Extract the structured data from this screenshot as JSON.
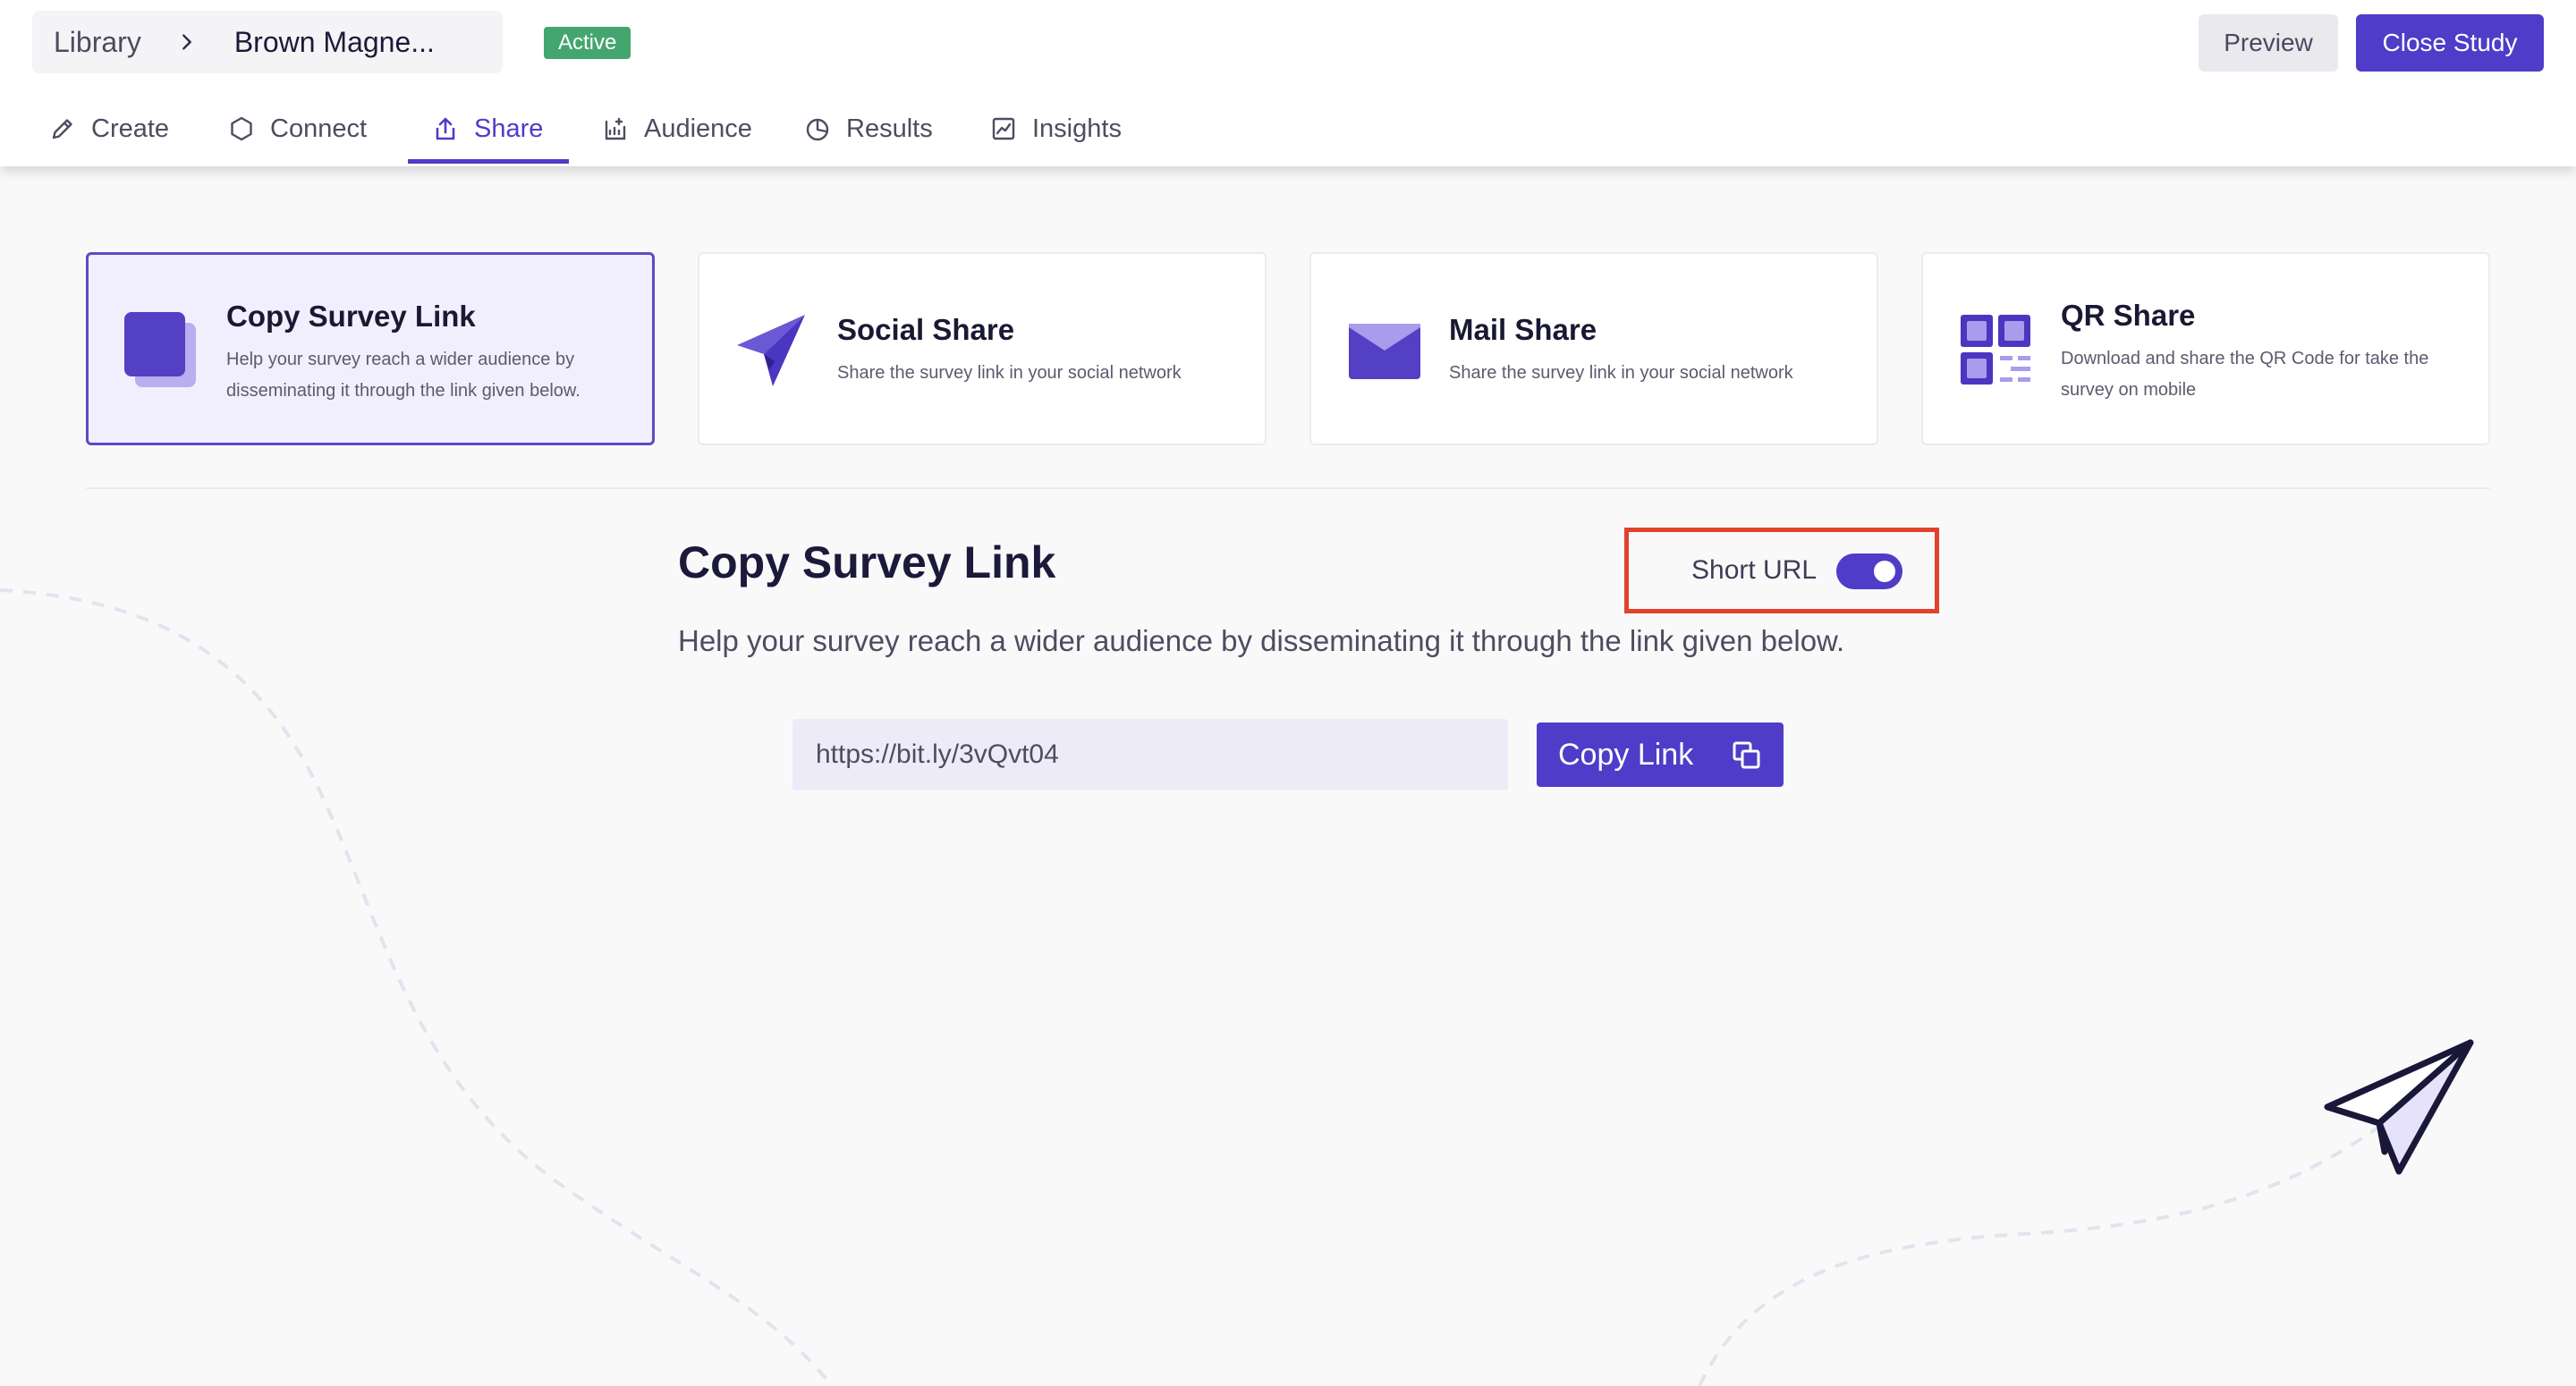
{
  "header": {
    "breadcrumb": {
      "library": "Library",
      "study": "Brown Magne..."
    },
    "status": "Active",
    "preview_label": "Preview",
    "close_label": "Close Study"
  },
  "tabs": [
    {
      "label": "Create",
      "icon": "pencil-icon"
    },
    {
      "label": "Connect",
      "icon": "hexagon-icon"
    },
    {
      "label": "Share",
      "icon": "share-upload-icon",
      "active": true
    },
    {
      "label": "Audience",
      "icon": "audience-icon"
    },
    {
      "label": "Results",
      "icon": "pie-chart-icon"
    },
    {
      "label": "Insights",
      "icon": "line-chart-icon"
    }
  ],
  "share_options": [
    {
      "title": "Copy Survey Link",
      "desc": "Help your survey reach a wider audience by disseminating it through the link given below.",
      "icon": "copy-squares-icon",
      "selected": true
    },
    {
      "title": "Social Share",
      "desc": "Share the survey link in your social network",
      "icon": "paper-plane-icon"
    },
    {
      "title": "Mail Share",
      "desc": "Share the survey link in your social network",
      "icon": "mail-icon"
    },
    {
      "title": "QR Share",
      "desc": "Download and share the QR Code for take the survey on mobile",
      "icon": "qr-code-icon"
    }
  ],
  "copy_section": {
    "title": "Copy Survey Link",
    "description": "Help your survey reach a wider audience by disseminating it through the link given below.",
    "short_url_label": "Short URL",
    "short_url_enabled": true,
    "link_value": "https://bit.ly/3vQvt04",
    "copy_button_label": "Copy Link"
  },
  "colors": {
    "accent": "#4f3cc8",
    "active_badge": "#43a66f",
    "highlight_border": "#e2422b",
    "background": "#f9f9fa"
  }
}
